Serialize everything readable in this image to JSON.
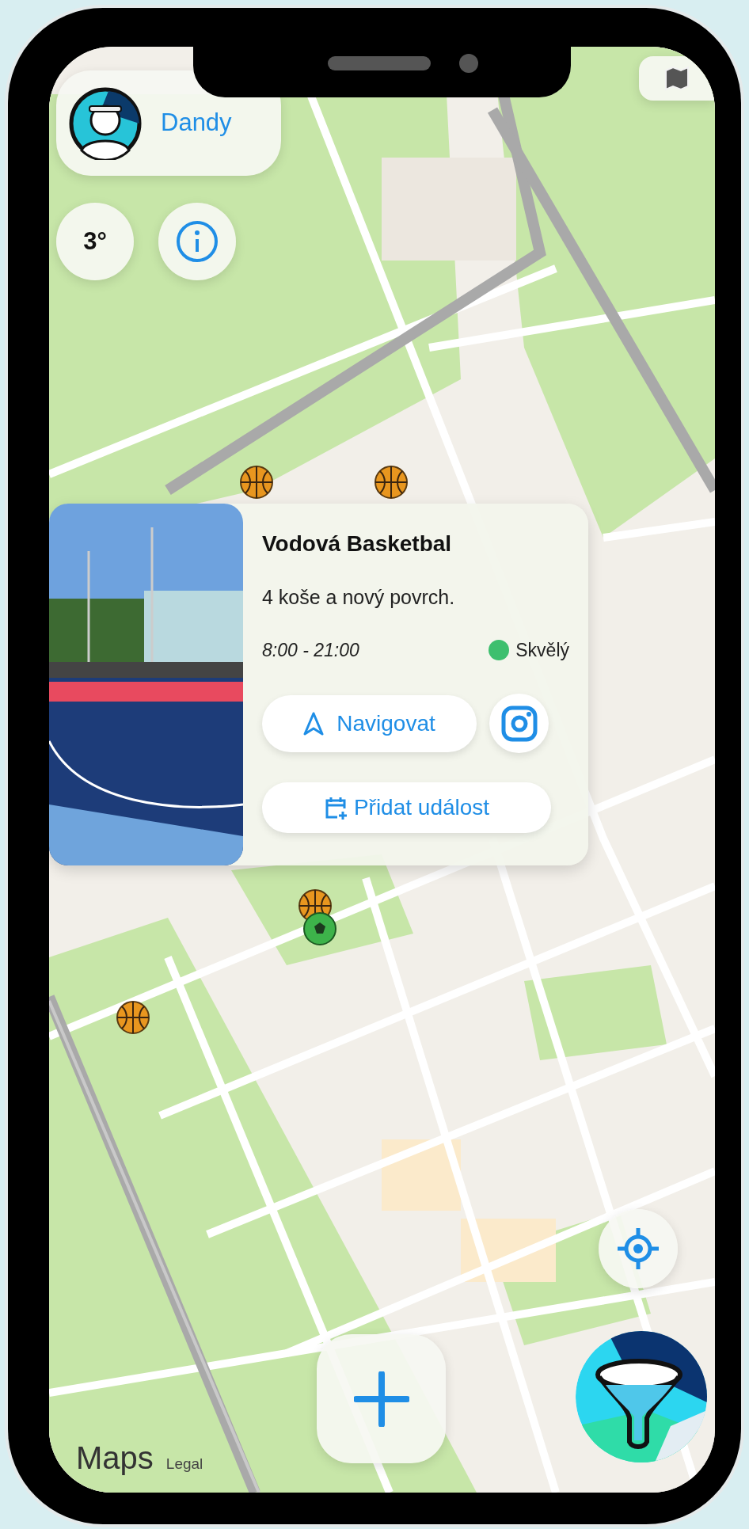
{
  "profile": {
    "name": "Dandy"
  },
  "weather": {
    "temperature": "3°"
  },
  "markers": [
    {
      "kind": "basketball"
    },
    {
      "kind": "basketball"
    },
    {
      "kind": "basketball"
    },
    {
      "kind": "football"
    },
    {
      "kind": "basketball"
    }
  ],
  "spot": {
    "title": "Vodová Basketbal",
    "description": "4 koše a nový povrch.",
    "hours": "8:00 - 21:00",
    "status": {
      "label": "Skvělý",
      "color": "#3dbf6e"
    },
    "navigate": "Navigovat",
    "add_event": "Přidat událost"
  },
  "attribution": {
    "brand": "Maps",
    "legal": "Legal"
  }
}
